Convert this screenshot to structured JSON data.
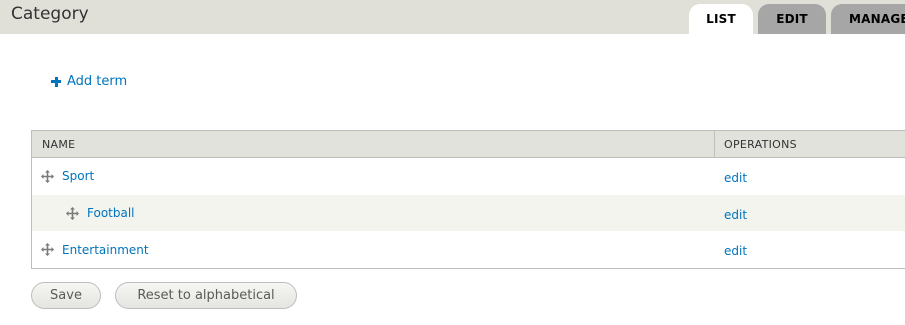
{
  "header": {
    "title": "Category",
    "tabs": [
      {
        "label": "LIST",
        "active": true
      },
      {
        "label": "EDIT",
        "active": false
      },
      {
        "label": "MANAGE",
        "active": false
      }
    ]
  },
  "actions": {
    "add_term_label": "Add term"
  },
  "table": {
    "columns": [
      "NAME",
      "OPERATIONS"
    ],
    "rows": [
      {
        "name": "Sport",
        "operation": "edit",
        "depth": 0
      },
      {
        "name": "Football",
        "operation": "edit",
        "depth": 1
      },
      {
        "name": "Entertainment",
        "operation": "edit",
        "depth": 0
      }
    ]
  },
  "buttons": {
    "save_label": "Save",
    "reset_label": "Reset to alphabetical"
  },
  "colors": {
    "link": "#0074bd",
    "header_bg": "#e0e0d8",
    "tab_inactive": "#a6a6a6"
  },
  "icons": {
    "add": "plus-icon",
    "drag": "drag-handle-icon"
  }
}
